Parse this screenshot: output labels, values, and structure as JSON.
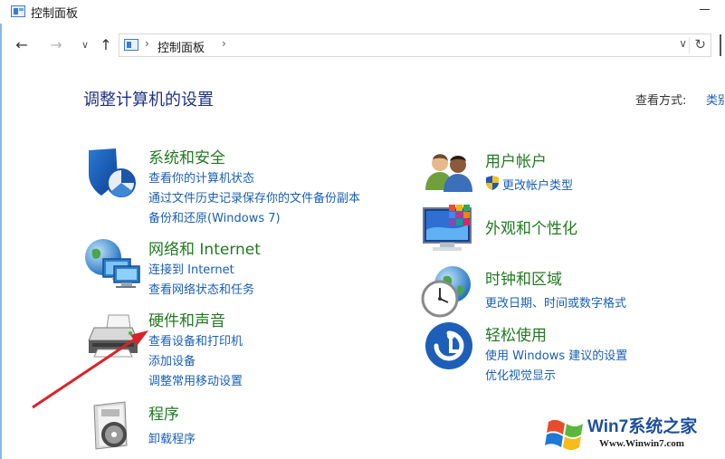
{
  "window": {
    "title": "控制面板"
  },
  "nav": {
    "back_icon": "←",
    "forward_icon": "→",
    "recent_icon": "∨",
    "up_icon": "↑"
  },
  "address": {
    "sep1": "›",
    "path": "控制面板",
    "sep2": "›",
    "dropdown_icon": "∨",
    "refresh_icon": "↻"
  },
  "main": {
    "title": "调整计算机的设置",
    "view_by_label": "查看方式:",
    "view_by_value": "类别"
  },
  "categories": {
    "system": {
      "title": "系统和安全",
      "links": [
        "查看你的计算机状态",
        "通过文件历史记录保存你的文件备份副本",
        "备份和还原(Windows 7)"
      ]
    },
    "network": {
      "title": "网络和 Internet",
      "links": [
        "连接到 Internet",
        "查看网络状态和任务"
      ]
    },
    "hardware": {
      "title": "硬件和声音",
      "links": [
        "查看设备和打印机",
        "添加设备",
        "调整常用移动设置"
      ]
    },
    "programs": {
      "title": "程序",
      "links": [
        "卸载程序"
      ]
    },
    "users": {
      "title": "用户帐户",
      "links": [
        "更改帐户类型"
      ]
    },
    "appearance": {
      "title": "外观和个性化",
      "links": []
    },
    "clock": {
      "title": "时钟和区域",
      "links": [
        "更改日期、时间或数字格式"
      ]
    },
    "ease": {
      "title": "轻松使用",
      "links": [
        "使用 Windows 建议的设置",
        "优化视觉显示"
      ]
    }
  },
  "watermark": {
    "line1": "Win7系统之家",
    "line2": "Www.Winwin7.com"
  },
  "colors": {
    "category_title": "#217a21",
    "link": "#1a5fb4",
    "heading": "#1e3287",
    "annotation_arrow": "#d9232a"
  }
}
